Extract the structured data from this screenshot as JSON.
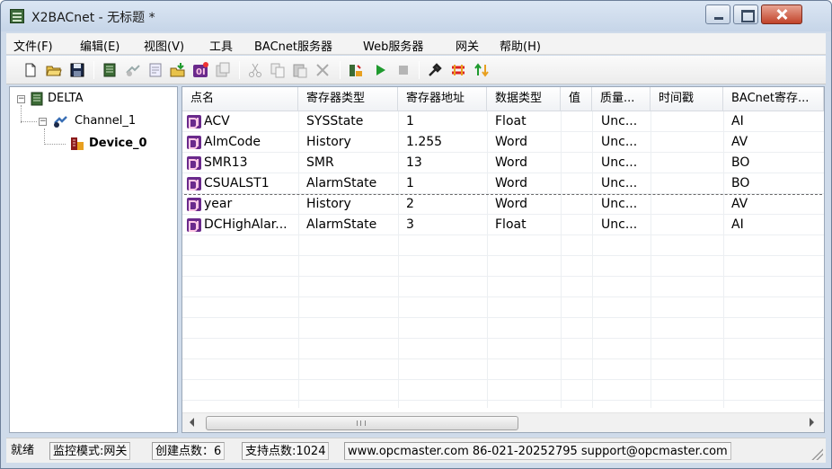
{
  "window": {
    "title": "X2BACnet - 无标题 *"
  },
  "menu": [
    "文件(F)",
    "编辑(E)",
    "视图(V)",
    "工具",
    "BACnet服务器",
    "Web服务器",
    "网关",
    "帮助(H)"
  ],
  "toolbar_icons": [
    "new-icon",
    "open-icon",
    "save-icon",
    "new-channel-icon",
    "new-device-icon",
    "properties-icon",
    "import-icon",
    "new-point-icon",
    "copy-device-icon",
    "cut-icon",
    "copy-icon",
    "paste-icon",
    "delete-icon",
    "monitor-icon",
    "run-icon",
    "stop-icon",
    "tools-icon",
    "bacnet-icon",
    "gateway-icon"
  ],
  "tree": {
    "root": "DELTA",
    "channel": "Channel_1",
    "device": "Device_0"
  },
  "columns": [
    "点名",
    "寄存器类型",
    "寄存器地址",
    "数据类型",
    "值",
    "质量...",
    "时间戳",
    "BACnet寄存..."
  ],
  "rows": [
    {
      "name": "ACV",
      "reg_type": "SYSState",
      "reg_addr": "1",
      "data_type": "Float",
      "value": "",
      "quality": "Unc...",
      "timestamp": "",
      "bacnet": "AI"
    },
    {
      "name": "AlmCode",
      "reg_type": "History",
      "reg_addr": "1.255",
      "data_type": "Word",
      "value": "",
      "quality": "Unc...",
      "timestamp": "",
      "bacnet": "AV"
    },
    {
      "name": "SMR13",
      "reg_type": "SMR",
      "reg_addr": "13",
      "data_type": "Word",
      "value": "",
      "quality": "Unc...",
      "timestamp": "",
      "bacnet": "BO"
    },
    {
      "name": "CSUALST1",
      "reg_type": "AlarmState",
      "reg_addr": "1",
      "data_type": "Word",
      "value": "",
      "quality": "Unc...",
      "timestamp": "",
      "bacnet": "BO"
    },
    {
      "name": "year",
      "reg_type": "History",
      "reg_addr": "2",
      "data_type": "Word",
      "value": "",
      "quality": "Unc...",
      "timestamp": "",
      "bacnet": "AV"
    },
    {
      "name": "DCHighAlar...",
      "reg_type": "AlarmState",
      "reg_addr": "3",
      "data_type": "Float",
      "value": "",
      "quality": "Unc...",
      "timestamp": "",
      "bacnet": "AI"
    }
  ],
  "scrollbar": {
    "grip": "III"
  },
  "status": {
    "ready": "就绪",
    "mode": "监控模式:网关",
    "created": "创建点数：6",
    "supported": "支持点数:1024",
    "contact": "www.opcmaster.com  86-021-20252795  support@opcmaster.com"
  },
  "colors": {
    "titlebar": "#cfdbea",
    "point_icon": "#6a2a8c",
    "accent_green": "#1f9a2e"
  }
}
